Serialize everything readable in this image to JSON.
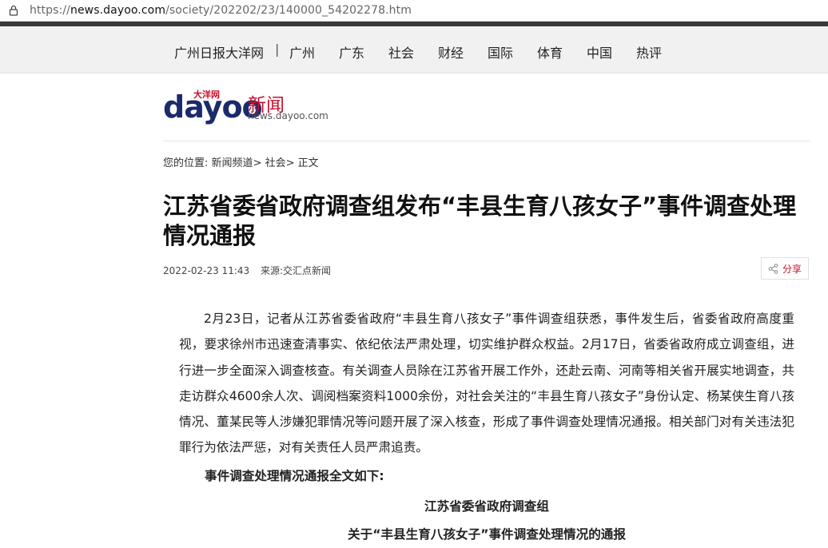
{
  "browser": {
    "url_scheme": "https://",
    "url_host": "news.dayoo.com",
    "url_path": "/society/202202/23/140000_54202278.htm"
  },
  "nav": {
    "items": [
      "广州日报大洋网",
      "广州",
      "广东",
      "社会",
      "财经",
      "国际",
      "体育",
      "中国",
      "热评"
    ],
    "separator": "|"
  },
  "logo": {
    "brand": "dayoo",
    "brand_cn": "大洋网",
    "section": "新闻",
    "domain": "news.dayoo.com"
  },
  "breadcrumb": {
    "prefix": "您的位置:",
    "items": [
      "新闻频道",
      "社会",
      "正文"
    ],
    "separator": ">"
  },
  "article": {
    "title": "江苏省委省政府调查组发布“丰县生育八孩女子”事件调查处理情况通报",
    "datetime": "2022-02-23 11:43",
    "source": "来源:交汇点新闻",
    "share_label": "分享",
    "paragraph": "2月23日，记者从江苏省委省政府“丰县生育八孩女子”事件调查组获悉，事件发生后，省委省政府高度重视，要求徐州市迅速查清事实、依纪依法严肃处理，切实维护群众权益。2月17日，省委省政府成立调查组，进行进一步全面深入调查核查。有关调查人员除在江苏省开展工作外，还赴云南、河南等相关省开展实地调查，共走访群众4600余人次、调阅档案资料1000余份，对社会关注的“丰县生育八孩女子”身份认定、杨某侠生育八孩情况、董某民等人涉嫌犯罪情况等问题开展了深入核查，形成了事件调查处理情况通报。相关部门对有关违法犯罪行为依法严惩，对有关责任人员严肃追责。",
    "subhead": "事件调查处理情况通报全文如下:",
    "org_line": "江苏省委省政府调查组",
    "doc_title": "关于“丰县生育八孩女子”事件调查处理情况的通报"
  },
  "colors": {
    "brand_navy": "#1a2a6b",
    "accent_red": "#c8102e",
    "nav_bg": "#f1f1f1"
  }
}
